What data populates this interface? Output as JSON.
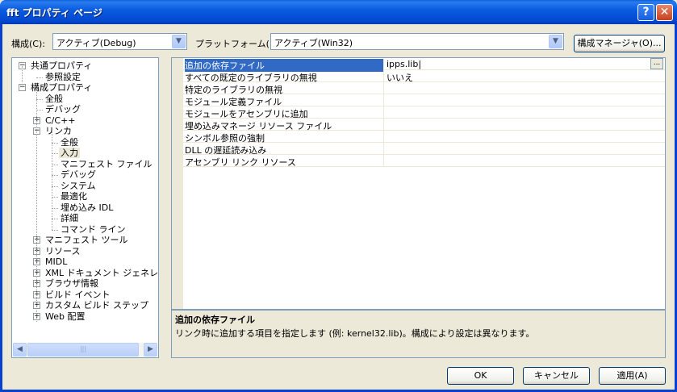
{
  "window": {
    "title": "fft プロパティ ページ",
    "help_label": "?",
    "close_label": "✕"
  },
  "toolbar": {
    "config_label": "構成(C):",
    "config_value": "アクティブ(Debug)",
    "platform_label": "プラットフォーム(P):",
    "platform_value": "アクティブ(Win32)",
    "config_manager_label": "構成マネージャ(O)..."
  },
  "tree": {
    "items": [
      {
        "label": "共通プロパティ",
        "level": 0,
        "expander": "−"
      },
      {
        "label": "参照設定",
        "level": 1,
        "expander": ""
      },
      {
        "label": "構成プロパティ",
        "level": 0,
        "expander": "−"
      },
      {
        "label": "全般",
        "level": 1,
        "expander": ""
      },
      {
        "label": "デバッグ",
        "level": 1,
        "expander": ""
      },
      {
        "label": "C/C++",
        "level": 1,
        "expander": "+"
      },
      {
        "label": "リンカ",
        "level": 1,
        "expander": "−"
      },
      {
        "label": "全般",
        "level": 2,
        "expander": ""
      },
      {
        "label": "入力",
        "level": 2,
        "expander": "",
        "selected": true
      },
      {
        "label": "マニフェスト ファイル",
        "level": 2,
        "expander": ""
      },
      {
        "label": "デバッグ",
        "level": 2,
        "expander": ""
      },
      {
        "label": "システム",
        "level": 2,
        "expander": ""
      },
      {
        "label": "最適化",
        "level": 2,
        "expander": ""
      },
      {
        "label": "埋め込み IDL",
        "level": 2,
        "expander": ""
      },
      {
        "label": "詳細",
        "level": 2,
        "expander": ""
      },
      {
        "label": "コマンド ライン",
        "level": 2,
        "expander": ""
      },
      {
        "label": "マニフェスト ツール",
        "level": 1,
        "expander": "+"
      },
      {
        "label": "リソース",
        "level": 1,
        "expander": "+"
      },
      {
        "label": "MIDL",
        "level": 1,
        "expander": "+"
      },
      {
        "label": "XML ドキュメント ジェネレータ",
        "level": 1,
        "expander": "+"
      },
      {
        "label": "ブラウザ情報",
        "level": 1,
        "expander": "+"
      },
      {
        "label": "ビルド イベント",
        "level": 1,
        "expander": "+"
      },
      {
        "label": "カスタム ビルド ステップ",
        "level": 1,
        "expander": "+"
      },
      {
        "label": "Web 配置",
        "level": 1,
        "expander": "+"
      }
    ],
    "scroll_left": "◀",
    "scroll_right": "▶",
    "scroll_grip": "|||"
  },
  "properties": [
    {
      "name": "追加の依存ファイル",
      "value": "ipps.lib|",
      "selected": true
    },
    {
      "name": "すべての既定のライブラリの無視",
      "value": "いいえ"
    },
    {
      "name": "特定のライブラリの無視",
      "value": ""
    },
    {
      "name": "モジュール定義ファイル",
      "value": ""
    },
    {
      "name": "モジュールをアセンブリに追加",
      "value": ""
    },
    {
      "name": "埋め込みマネージ リソース ファイル",
      "value": ""
    },
    {
      "name": "シンボル参照の強制",
      "value": ""
    },
    {
      "name": "DLL の遅延読み込み",
      "value": ""
    },
    {
      "name": "アセンブリ リンク リソース",
      "value": ""
    }
  ],
  "ellipsis_label": "...",
  "description": {
    "title": "追加の依存ファイル",
    "text": "リンク時に追加する項目を指定します (例: kernel32.lib)。構成により設定は異なります。"
  },
  "buttons": {
    "ok": "OK",
    "cancel": "キャンセル",
    "apply": "適用(A)"
  }
}
